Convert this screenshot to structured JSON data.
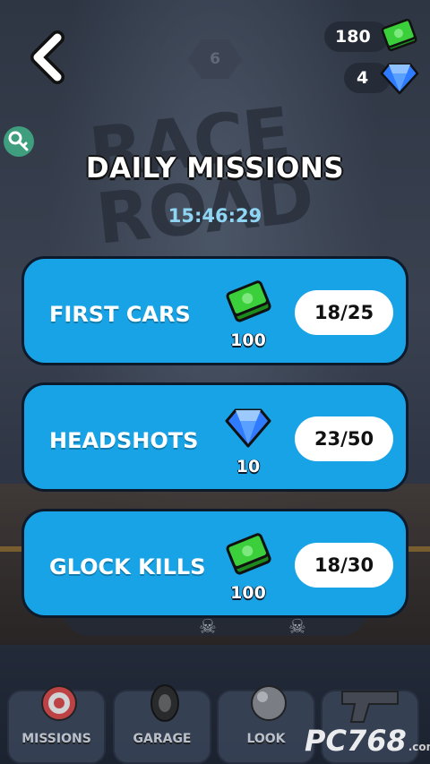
{
  "header": {
    "level": "6",
    "cash": "180",
    "gems": "4"
  },
  "background": {
    "title_line1": "RACE",
    "title_line2": "ROAD"
  },
  "title": "DAILY MISSIONS",
  "timer": "15:46:29",
  "missions": [
    {
      "name": "FIRST CARS",
      "reward_type": "cash-icon",
      "reward": "100",
      "progress": "18/25"
    },
    {
      "name": "HEADSHOTS",
      "reward_type": "gem-icon",
      "reward": "10",
      "progress": "23/50"
    },
    {
      "name": "GLOCK KILLS",
      "reward_type": "cash-icon",
      "reward": "100",
      "progress": "18/30"
    }
  ],
  "nav": {
    "tabs": [
      {
        "label": "MISSIONS",
        "icon": "target-icon"
      },
      {
        "label": "GARAGE",
        "icon": "tire-icon"
      },
      {
        "label": "LOOK",
        "icon": "ball-icon"
      },
      {
        "label": "",
        "icon": "pistol-icon"
      }
    ]
  },
  "watermark": {
    "text": "PC768",
    "suffix": ".com"
  },
  "colors": {
    "card": "#18a3e6",
    "cash": "#3ccf3c",
    "gem": "#2f7bff",
    "timer": "#8fd6f5"
  }
}
